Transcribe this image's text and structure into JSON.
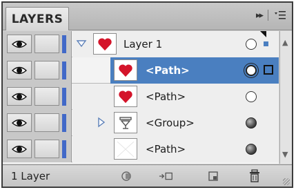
{
  "panel": {
    "tab_label": "LAYERS",
    "collapse_symbol": "▸▸",
    "footer_label": "1 Layer"
  },
  "rows": [
    {
      "name": "Layer 1",
      "type": "layer",
      "expanded": true,
      "thumb": "heart-icon",
      "target": "empty",
      "selected": false,
      "indicator": "small-square"
    },
    {
      "name": "<Path>",
      "type": "path",
      "thumb": "heart-icon",
      "target": "selected-target",
      "selected": true,
      "indicator": "outline-square"
    },
    {
      "name": "<Path>",
      "type": "path",
      "thumb": "heart-icon",
      "target": "empty",
      "selected": false
    },
    {
      "name": "<Group>",
      "type": "group",
      "expanded": false,
      "thumb": "cup-icon",
      "target": "filled",
      "selected": false
    },
    {
      "name": "<Path>",
      "type": "path",
      "thumb": "blank",
      "target": "filled",
      "selected": false
    }
  ],
  "colors": {
    "selection": "#4a7fc0",
    "layer_color": "#4169c8",
    "heart": "#d4142a"
  },
  "icons": {
    "visibility": "eye-icon",
    "lock_toggle": "lock-toggle",
    "footer_buttons": [
      "make-clipping-mask-icon",
      "create-sublayer-icon",
      "create-new-layer-icon",
      "delete-layer-icon"
    ],
    "panel_menu": "panel-menu-icon"
  }
}
